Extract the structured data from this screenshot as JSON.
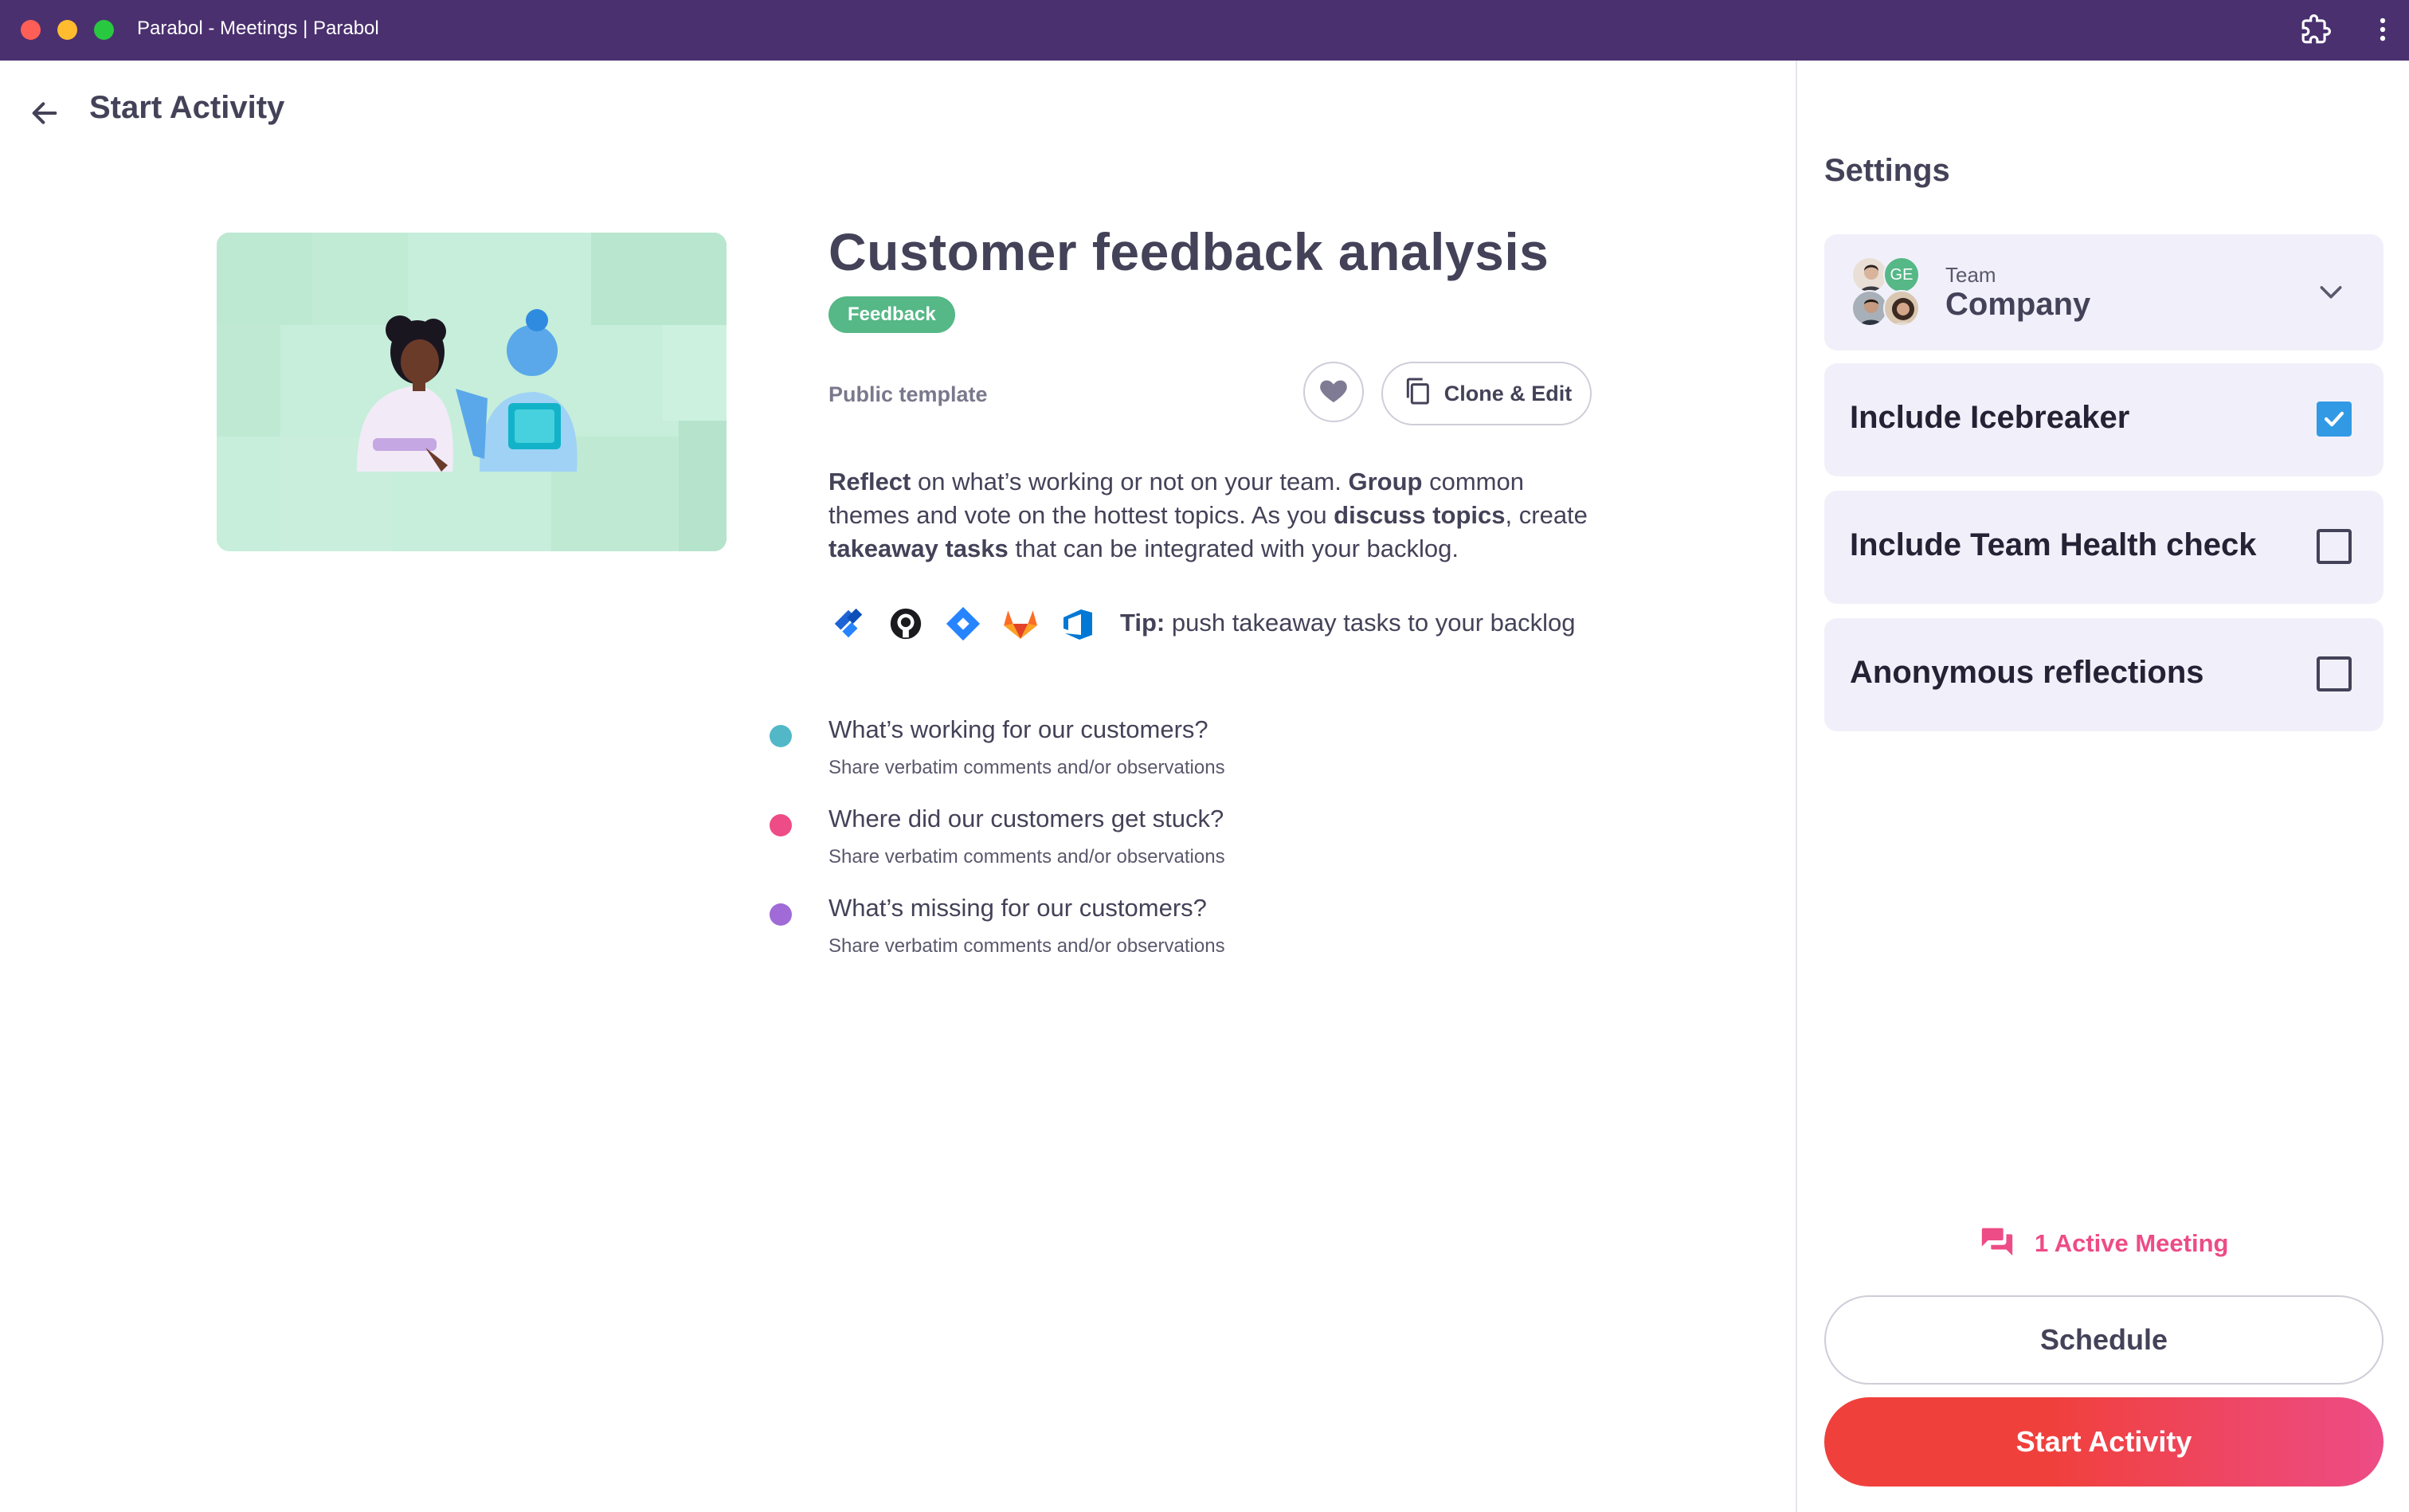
{
  "window": {
    "title": "Parabol - Meetings | Parabol"
  },
  "header": {
    "title": "Start Activity"
  },
  "template": {
    "title": "Customer feedback analysis",
    "tag": "Feedback",
    "visibility": "Public template",
    "clone_label": "Clone & Edit",
    "description": {
      "p1_bold": "Reflect",
      "p1": " on what’s working or not on your team. ",
      "p2_bold": "Group",
      "p2": " common themes and vote on the hottest topics. As you ",
      "p3_bold": "discuss topics",
      "p3": ", create ",
      "p4_bold": "takeaway tasks",
      "p4": " that can be integrated with your backlog."
    },
    "tip_label": "Tip:",
    "tip_text": " push takeaway tasks to your backlog",
    "integration_icons": [
      "jira-icon",
      "github-icon",
      "jira-server-icon",
      "gitlab-icon",
      "azure-devops-icon"
    ],
    "prompts": [
      {
        "question": "What’s working for our customers?",
        "description": "Share verbatim comments and/or observations",
        "color": "#52b8c8"
      },
      {
        "question": "Where did our customers get stuck?",
        "description": "Share verbatim comments and/or observations",
        "color": "#ed4c86"
      },
      {
        "question": "What’s missing for our customers?",
        "description": "Share verbatim comments and/or observations",
        "color": "#a06bd6"
      }
    ]
  },
  "settings": {
    "title": "Settings",
    "team": {
      "label": "Team",
      "name": "Company",
      "avatar_initials": "GE"
    },
    "options": [
      {
        "label": "Include Icebreaker",
        "checked": true
      },
      {
        "label": "Include Team Health check",
        "checked": false
      },
      {
        "label": "Anonymous reflections",
        "checked": false
      }
    ],
    "active_meeting": "1 Active Meeting",
    "schedule_label": "Schedule",
    "start_label": "Start Activity"
  },
  "colors": {
    "titlebar": "#4a306f",
    "tag": "#55b886",
    "checkbox_on": "#329ae5",
    "active_meeting": "#ed4c86",
    "start_gradient_from": "#f0403c",
    "start_gradient_to": "#ed4c86"
  }
}
